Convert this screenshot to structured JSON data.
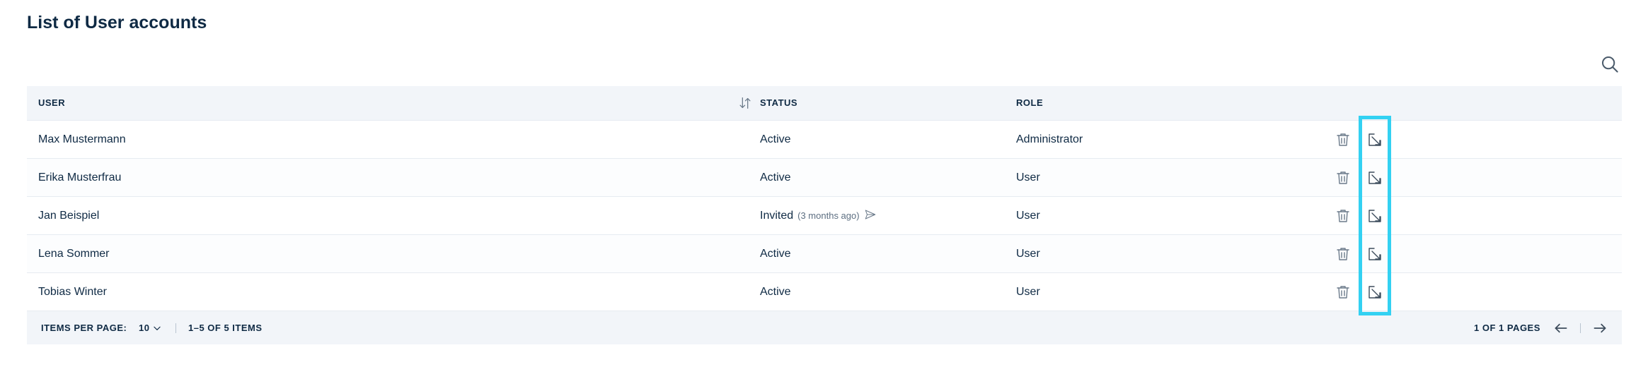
{
  "page": {
    "title": "List of User accounts"
  },
  "table": {
    "columns": {
      "user": "USER",
      "status": "STATUS",
      "role": "ROLE"
    },
    "rows": [
      {
        "user": "Max Mustermann",
        "status": "Active",
        "status_note": "",
        "role": "Administrator"
      },
      {
        "user": "Erika Musterfrau",
        "status": "Active",
        "status_note": "",
        "role": "User"
      },
      {
        "user": "Jan Beispiel",
        "status": "Invited",
        "status_note": "(3 months ago)",
        "role": "User"
      },
      {
        "user": "Lena Sommer",
        "status": "Active",
        "status_note": "",
        "role": "User"
      },
      {
        "user": "Tobias Winter",
        "status": "Active",
        "status_note": "",
        "role": "User"
      }
    ]
  },
  "footer": {
    "items_per_page_label": "ITEMS PER PAGE:",
    "items_per_page_value": "10",
    "range": "1–5 OF 5 ITEMS",
    "pages": "1 OF 1 PAGES"
  },
  "icons": {
    "search": "search-icon",
    "sort": "sort-icon",
    "delete": "trash-icon",
    "edit": "edit-icon",
    "resend": "send-icon",
    "prev": "arrow-left-icon",
    "next": "arrow-right-icon",
    "dropdown": "chevron-down-icon"
  },
  "colors": {
    "text": "#0f2a44",
    "header_bg": "#f2f5f9",
    "highlight": "#33d1f2",
    "icon": "#6b7a8a"
  }
}
